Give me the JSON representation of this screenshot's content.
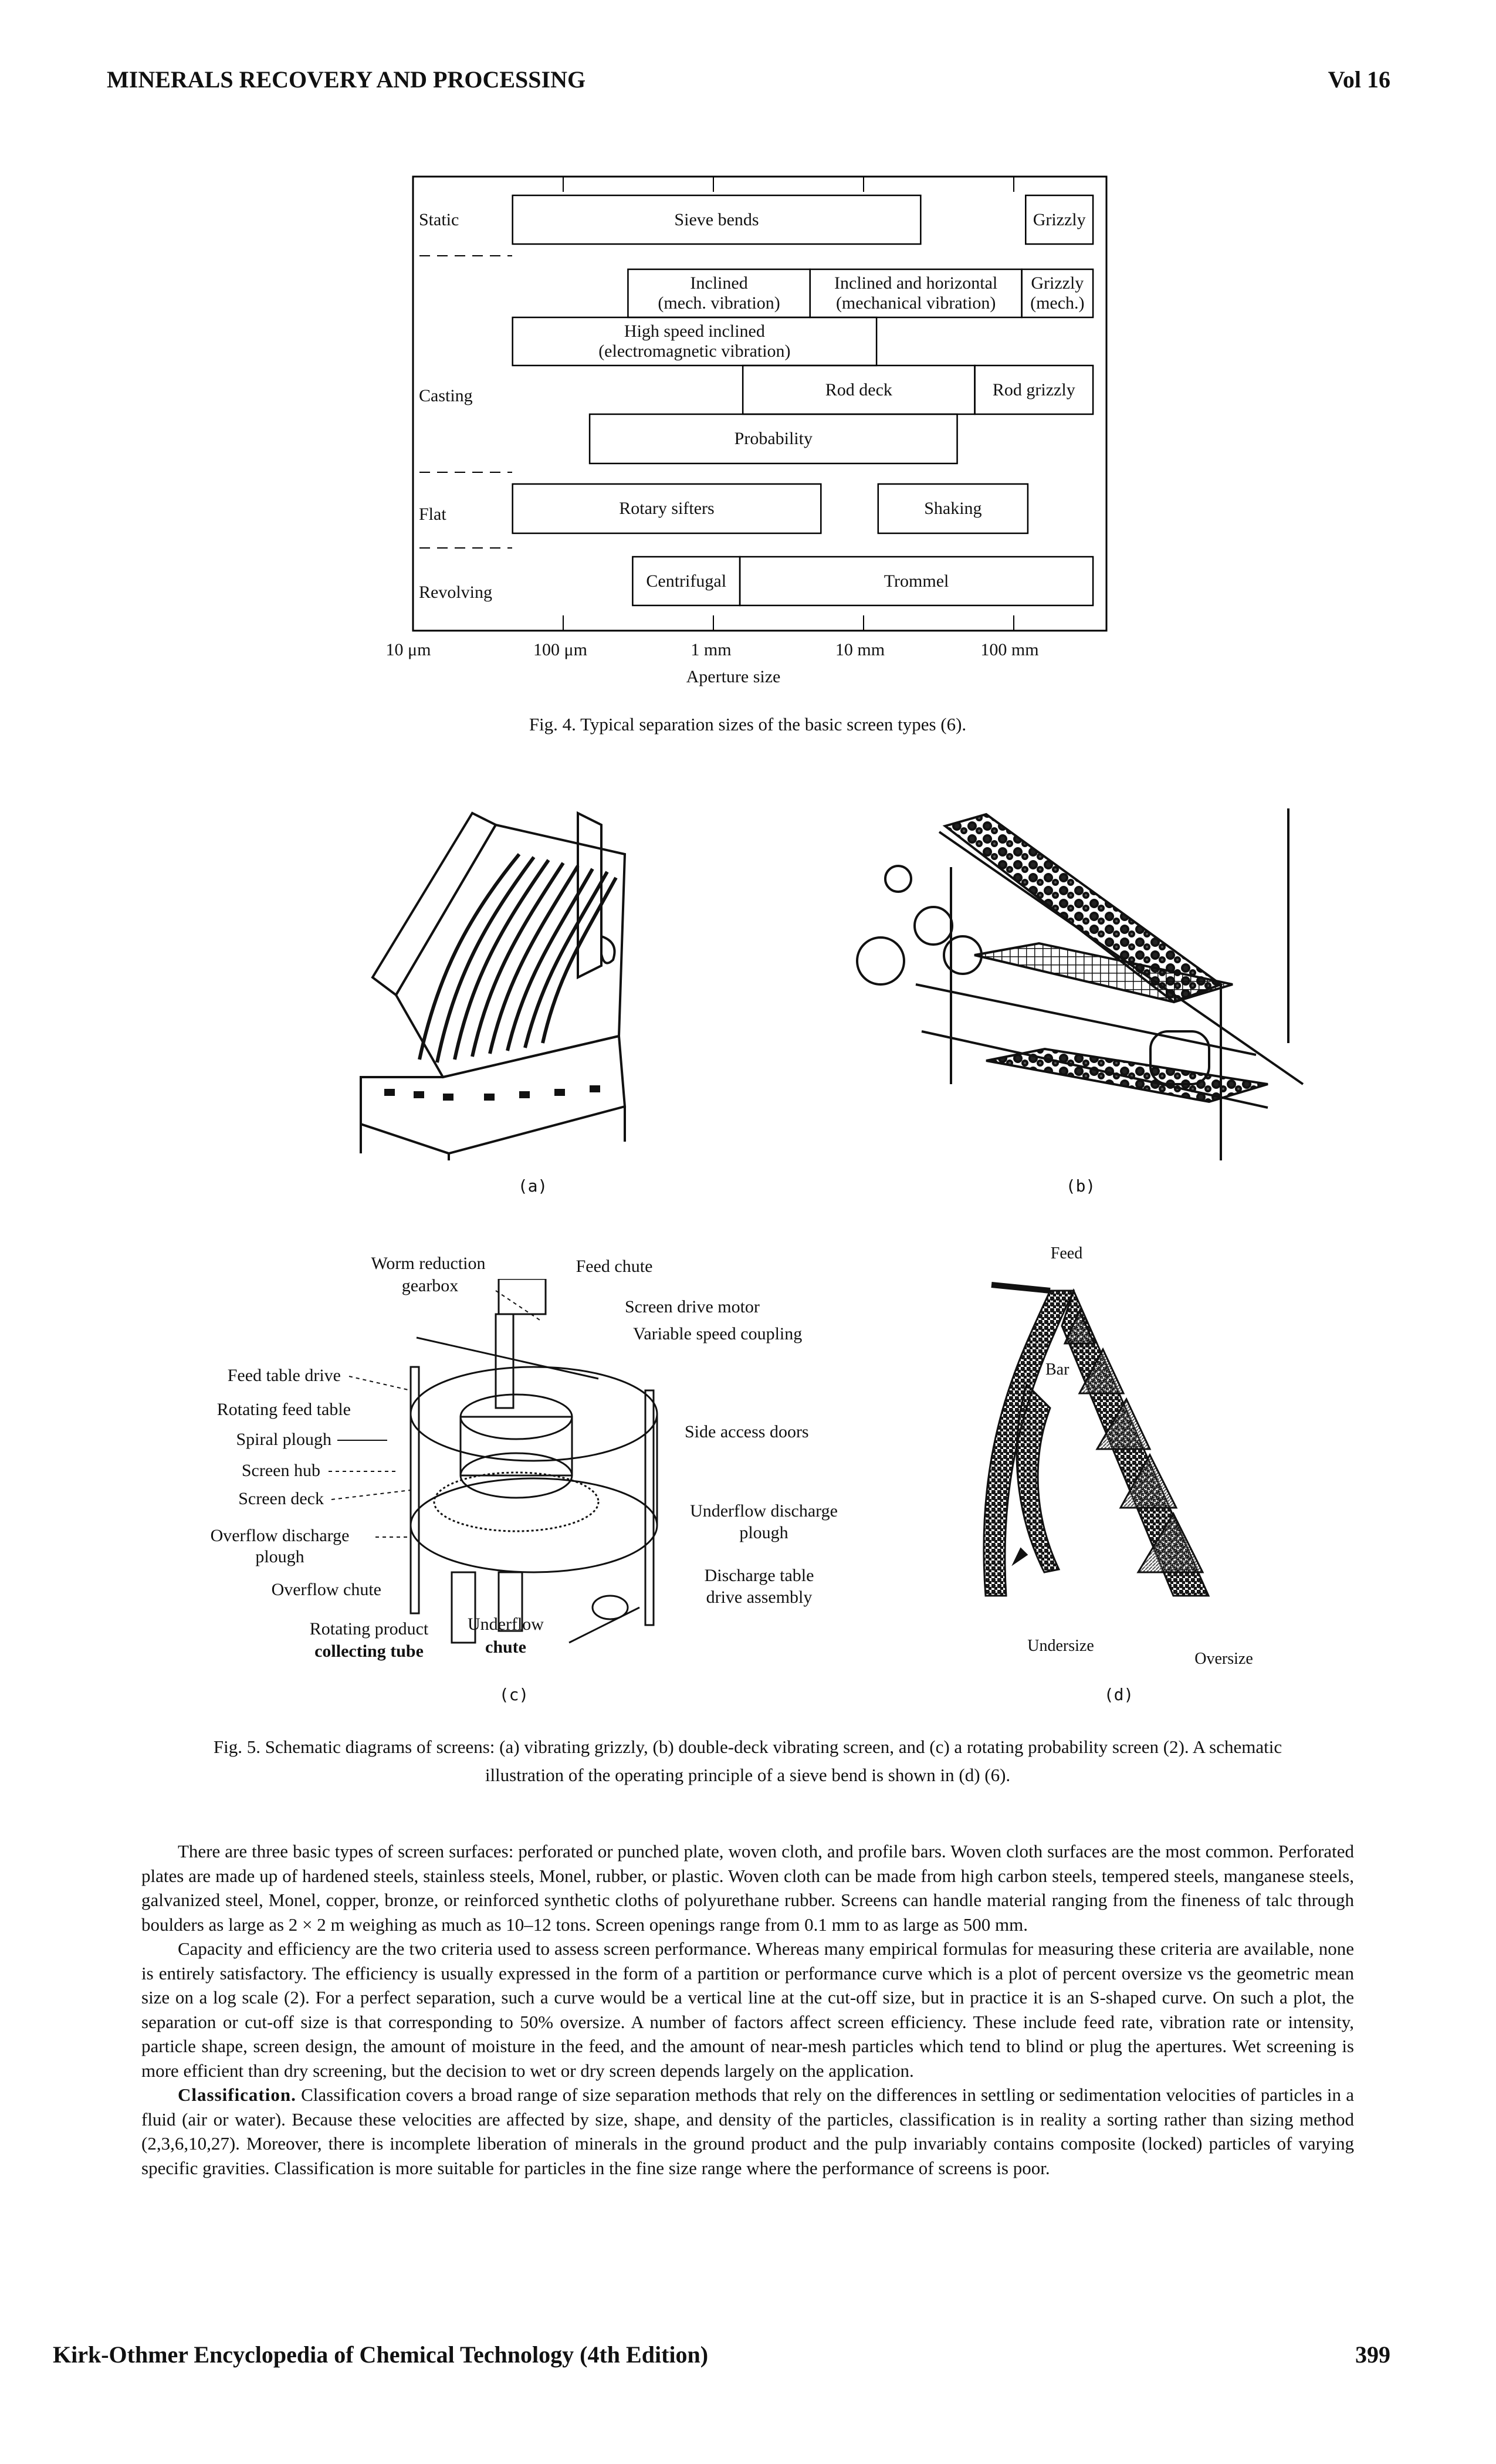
{
  "header": {
    "left": "MINERALS RECOVERY AND PROCESSING",
    "right": "Vol 16"
  },
  "footer": {
    "left": "Kirk-Othmer Encyclopedia of Chemical Technology (4th Edition)",
    "right": "399"
  },
  "fig4": {
    "rows": [
      "Static",
      "Casting",
      "Flat",
      "Revolving"
    ],
    "boxes": [
      {
        "label": [
          "Sieve bends"
        ],
        "from_mm": 0.046,
        "to_mm": 24
      },
      {
        "label": [
          "Grizzly"
        ],
        "from_mm": 120,
        "to_mm": 337
      },
      {
        "label": [
          "Inclined",
          "(mech. vibration)"
        ],
        "from_mm": 0.27,
        "to_mm": 4.4
      },
      {
        "label": [
          "Inclined and horizontal",
          "(mechanical vibration)"
        ],
        "from_mm": 4.4,
        "to_mm": 113
      },
      {
        "label": [
          "Grizzly",
          "(mech.)"
        ],
        "from_mm": 113,
        "to_mm": 337
      },
      {
        "label": [
          "High speed inclined",
          "(electromagnetic vibration)"
        ],
        "from_mm": 0.046,
        "to_mm": 12.2
      },
      {
        "label": [
          "Rod deck"
        ],
        "from_mm": 1.57,
        "to_mm": 55
      },
      {
        "label": [
          "Rod grizzly"
        ],
        "from_mm": 55,
        "to_mm": 337
      },
      {
        "label": [
          "Probability"
        ],
        "from_mm": 0.15,
        "to_mm": 42
      },
      {
        "label": [
          "Rotary sifters"
        ],
        "from_mm": 0.046,
        "to_mm": 5.2
      },
      {
        "label": [
          "Shaking"
        ],
        "from_mm": 12.5,
        "to_mm": 124
      },
      {
        "label": [
          "Centrifugal"
        ],
        "from_mm": 0.29,
        "to_mm": 1.5
      },
      {
        "label": [
          "Trommel"
        ],
        "from_mm": 1.5,
        "to_mm": 337
      }
    ],
    "axis": {
      "scale": "log",
      "ticks": [
        "10 μm",
        "100 μm",
        "1 mm",
        "10 mm",
        "100 mm"
      ],
      "label": "Aperture size"
    },
    "caption": "Fig. 4. Typical separation sizes of the basic screen types (6)."
  },
  "fig5": {
    "a_label": "(a)",
    "b_label": "(b)",
    "c_label": "(c)",
    "d_label": "(d)",
    "c_callouts": {
      "worm1": "Worm reduction",
      "worm2": "gearbox",
      "feed_chute": "Feed chute",
      "motor": "Screen drive motor",
      "coupling": "Variable speed coupling",
      "feed_drive": "Feed table drive",
      "feed_table": "Rotating feed table",
      "spiral": "Spiral plough",
      "hub": "Screen hub",
      "deck": "Screen deck",
      "ovd1": "Overflow discharge",
      "ovd2": "plough",
      "ovc": "Overflow chute",
      "rpc1": "Rotating product",
      "rpc2": "collecting tube",
      "uc1": "Underflow",
      "uc2": "chute",
      "doors": "Side access doors",
      "ud1": "Underflow discharge",
      "ud2": "plough",
      "dt1": "Discharge table",
      "dt2": "drive assembly"
    },
    "d_callouts": {
      "feed": "Feed",
      "bar": "Bar",
      "undersize": "Undersize",
      "oversize": "Oversize"
    },
    "caption1": "Fig. 5. Schematic diagrams of screens: (a) vibrating grizzly, (b) double-deck vibrating screen, and (c) a rotating probability screen (2). A schematic",
    "caption2": "illustration of the operating principle of a sieve bend is shown in (d) (6)."
  },
  "body": {
    "p1": "There are three basic types of screen surfaces: perforated or punched plate, woven cloth, and profile bars. Woven cloth surfaces are the most common. Perforated plates are made up of hardened steels, stainless steels, Monel, rubber, or plastic. Woven cloth can be made from high carbon steels, tempered steels, manganese steels, galvanized steel, Monel, copper, bronze, or reinforced synthetic cloths of polyurethane rubber. Screens can handle material ranging from the fineness of talc through boulders as large as 2 × 2 m weighing as much as 10–12 tons. Screen openings range from 0.1 mm to as large as 500 mm.",
    "p2": "Capacity and efficiency are the two criteria used to assess screen performance. Whereas many empirical formulas for measuring these criteria are available, none is entirely satisfactory. The efficiency is usually expressed in the form of a partition or performance curve which is a plot of percent oversize vs the geometric mean size on a log scale (2). For a perfect separation, such a curve would be a vertical line at the cut-off size, but in practice it is an S-shaped curve. On such a plot, the separation or cut-off size is that corresponding to 50% oversize. A number of factors affect screen efficiency. These include feed rate, vibration rate or intensity, particle shape, screen design, the amount of moisture in the feed, and the amount of near-mesh particles which tend to blind or plug the apertures. Wet screening is more efficient than dry screening, but the decision to wet or dry screen depends largely on the application.",
    "p3_head": "Classification.",
    "p3": " Classification covers a broad range of size separation methods that rely on the differences in settling or sedimentation velocities of particles in a fluid (air or water). Because these velocities are affected by size, shape, and density of the particles, classification is in reality a sorting rather than sizing method (2,3,6,10,27). Moreover, there is incomplete liberation of minerals in the ground product and the pulp invariably contains composite (locked) particles of varying specific gravities. Classification is more suitable for particles in the fine size range where the performance of screens is poor."
  }
}
